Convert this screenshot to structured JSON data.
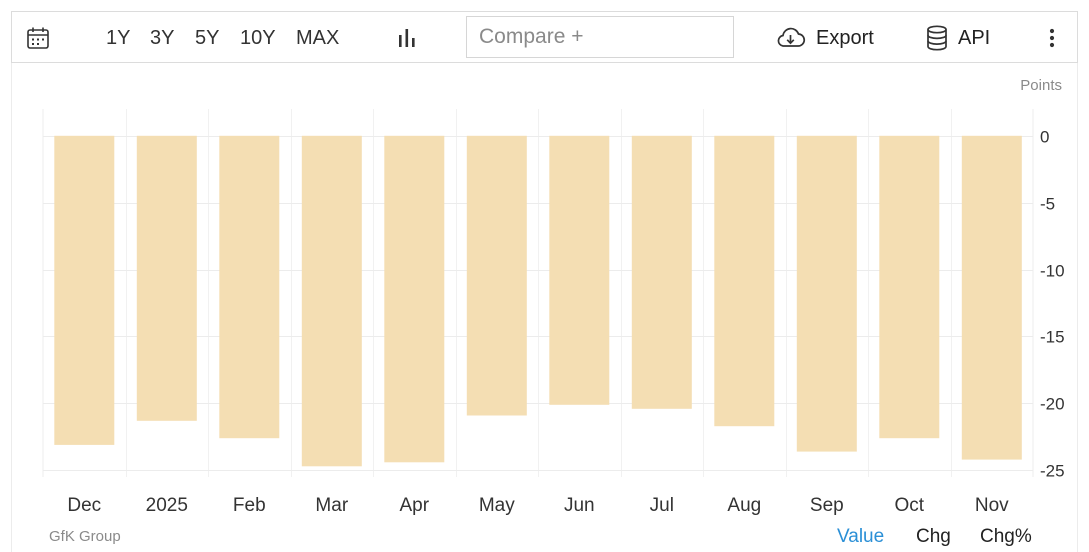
{
  "toolbar": {
    "calendar_icon": "calendar-icon",
    "ranges": [
      "1Y",
      "3Y",
      "5Y",
      "10Y",
      "MAX"
    ],
    "chart_type_icon": "bar-chart-icon",
    "compare_placeholder": "Compare +",
    "export_label": "Export",
    "export_icon": "cloud-download-icon",
    "api_label": "API",
    "api_icon": "database-icon",
    "more_icon": "vertical-ellipsis-icon"
  },
  "chart_data": {
    "type": "bar",
    "title": "",
    "xlabel": "",
    "ylabel": "Points",
    "categories": [
      "Dec",
      "2025",
      "Feb",
      "Mar",
      "Apr",
      "May",
      "Jun",
      "Jul",
      "Aug",
      "Sep",
      "Oct",
      "Nov"
    ],
    "values": [
      -23.1,
      -21.3,
      -22.6,
      -24.7,
      -24.4,
      -20.9,
      -20.1,
      -20.4,
      -21.7,
      -23.6,
      -22.6,
      -24.2
    ],
    "yticks": [
      "0",
      "-5",
      "-10",
      "-15",
      "-20",
      "-25"
    ],
    "ylim": [
      -25.5,
      2
    ],
    "grid": true,
    "legend": "none",
    "bar_color": "#f4deb3"
  },
  "footer": {
    "source": "GfK Group",
    "modes": [
      "Value",
      "Chg",
      "Chg%"
    ],
    "active_mode": "Value",
    "active_color": "#2a8fd6"
  }
}
